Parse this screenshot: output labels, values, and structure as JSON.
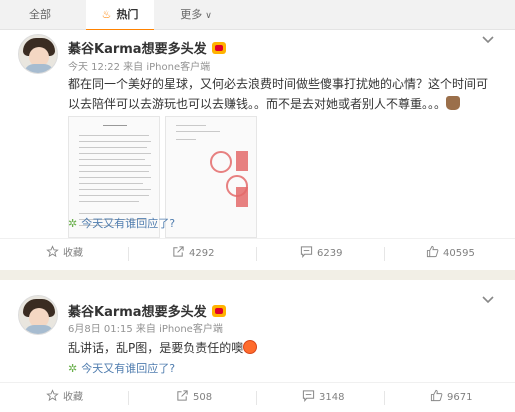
{
  "tabs": [
    {
      "label": "全部"
    },
    {
      "label": "热门"
    },
    {
      "label": "更多"
    }
  ],
  "posts": [
    {
      "name": "綦谷Karma想要多头发",
      "meta": "今天 12:22 来自 iPhone客户端",
      "text": "都在同一个美好的星球，又何必去浪费时间做些傻事打扰她的心情？这个时间可以去陪伴可以去游玩也可以去赚钱。。而不是去对她或者别人不尊重。。。",
      "topic": "今天又有谁回应了?",
      "actions": {
        "favorite": "收藏",
        "repost": "4292",
        "comment": "6239",
        "like": "40595"
      }
    },
    {
      "name": "綦谷Karma想要多头发",
      "meta": "6月8日 01:15 来自 iPhone客户端",
      "text": "乱讲话，乱P图，是要负责任的噢",
      "topic": "今天又有谁回应了?",
      "actions": {
        "favorite": "收藏",
        "repost": "508",
        "comment": "3148",
        "like": "9671"
      }
    }
  ],
  "colors": {
    "accent": "#ff8200",
    "link": "#507daf",
    "muted": "#939393"
  },
  "icons": [
    "flame-icon",
    "chevron-down-icon",
    "star-icon",
    "repost-icon",
    "comment-icon",
    "like-icon"
  ]
}
